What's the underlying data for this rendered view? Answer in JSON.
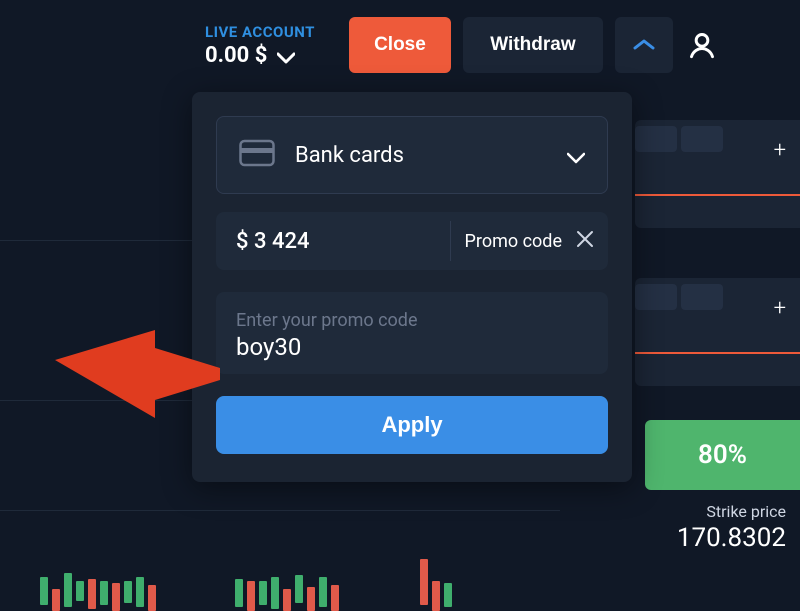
{
  "header": {
    "account_label": "LIVE ACCOUNT",
    "balance": "0.00 $",
    "close": "Close",
    "withdraw": "Withdraw"
  },
  "modal": {
    "payment_method": "Bank cards",
    "amount": "$ 3 424",
    "promo_label": "Promo code",
    "promo_placeholder": "Enter your promo code",
    "promo_value": "boy30",
    "apply": "Apply"
  },
  "side": {
    "profit": "80%",
    "strike_label": "Strike price",
    "strike_price": "170.8302",
    "plus": "+"
  },
  "colors": {
    "accent_orange": "#ee5a3a",
    "accent_blue": "#3a8ee6",
    "accent_green": "#4fb56d"
  }
}
